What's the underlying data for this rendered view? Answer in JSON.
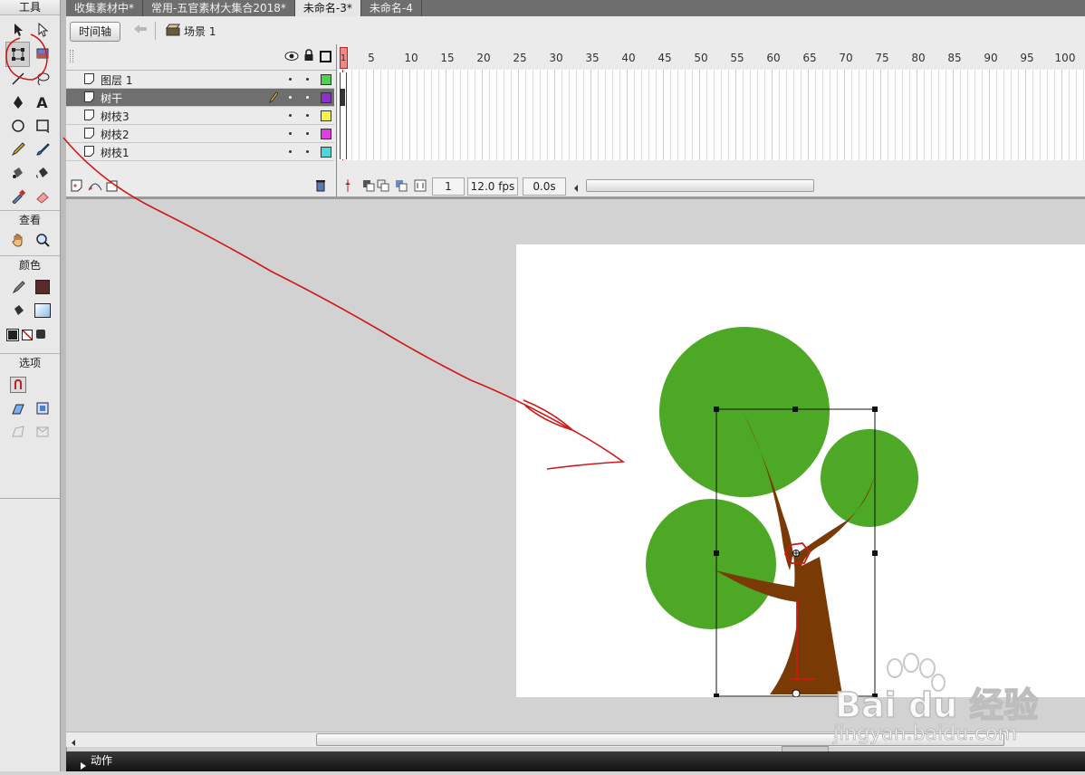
{
  "tools_panel": {
    "title": "工具",
    "view_label": "查看",
    "color_label": "颜色",
    "options_label": "选项",
    "tools": [
      "selection-tool",
      "subselection-tool",
      "free-transform-tool",
      "gradient-transform-tool",
      "line-tool",
      "lasso-tool",
      "pen-tool",
      "text-tool",
      "oval-tool",
      "rectangle-tool",
      "pencil-tool",
      "brush-tool",
      "ink-bottle-tool",
      "paint-bucket-tool",
      "eyedropper-tool",
      "eraser-tool"
    ],
    "view_tools": [
      "hand-tool",
      "zoom-tool"
    ],
    "stroke_color": "#5a2a2a",
    "fill_color": "#bcd8f0"
  },
  "doc_tabs": [
    {
      "label": "收集素材中*",
      "active": false
    },
    {
      "label": "常用-五官素材大集合2018*",
      "active": false
    },
    {
      "label": "未命名-3*",
      "active": true
    },
    {
      "label": "未命名-4",
      "active": false
    }
  ],
  "edit_bar": {
    "timeline_button": "时间轴",
    "scene_label": "场景 1"
  },
  "timeline": {
    "layers": [
      {
        "name": "图层 1",
        "color": "#4fd24f",
        "selected": false
      },
      {
        "name": "树干",
        "color": "#8a2fc8",
        "selected": true
      },
      {
        "name": "树枝3",
        "color": "#f2f24a",
        "selected": false
      },
      {
        "name": "树枝2",
        "color": "#e040e0",
        "selected": false
      },
      {
        "name": "树枝1",
        "color": "#4ad8d8",
        "selected": false
      }
    ],
    "ruler_numbers": [
      "1",
      "5",
      "10",
      "15",
      "20",
      "25",
      "30",
      "35",
      "40",
      "45",
      "50",
      "55",
      "60",
      "65",
      "70",
      "75",
      "80",
      "85",
      "90",
      "95",
      "100"
    ],
    "current_frame": "1",
    "frame_rate": "12.0 fps",
    "elapsed_time": "0.0s"
  },
  "stage": {
    "foliage_color": "#4ca825",
    "trunk_color": "#7a3a05"
  },
  "actions_panel": {
    "label": "动作"
  },
  "watermark": {
    "brand": "Bai du 经验",
    "url": "jingyan.baidu.com"
  }
}
